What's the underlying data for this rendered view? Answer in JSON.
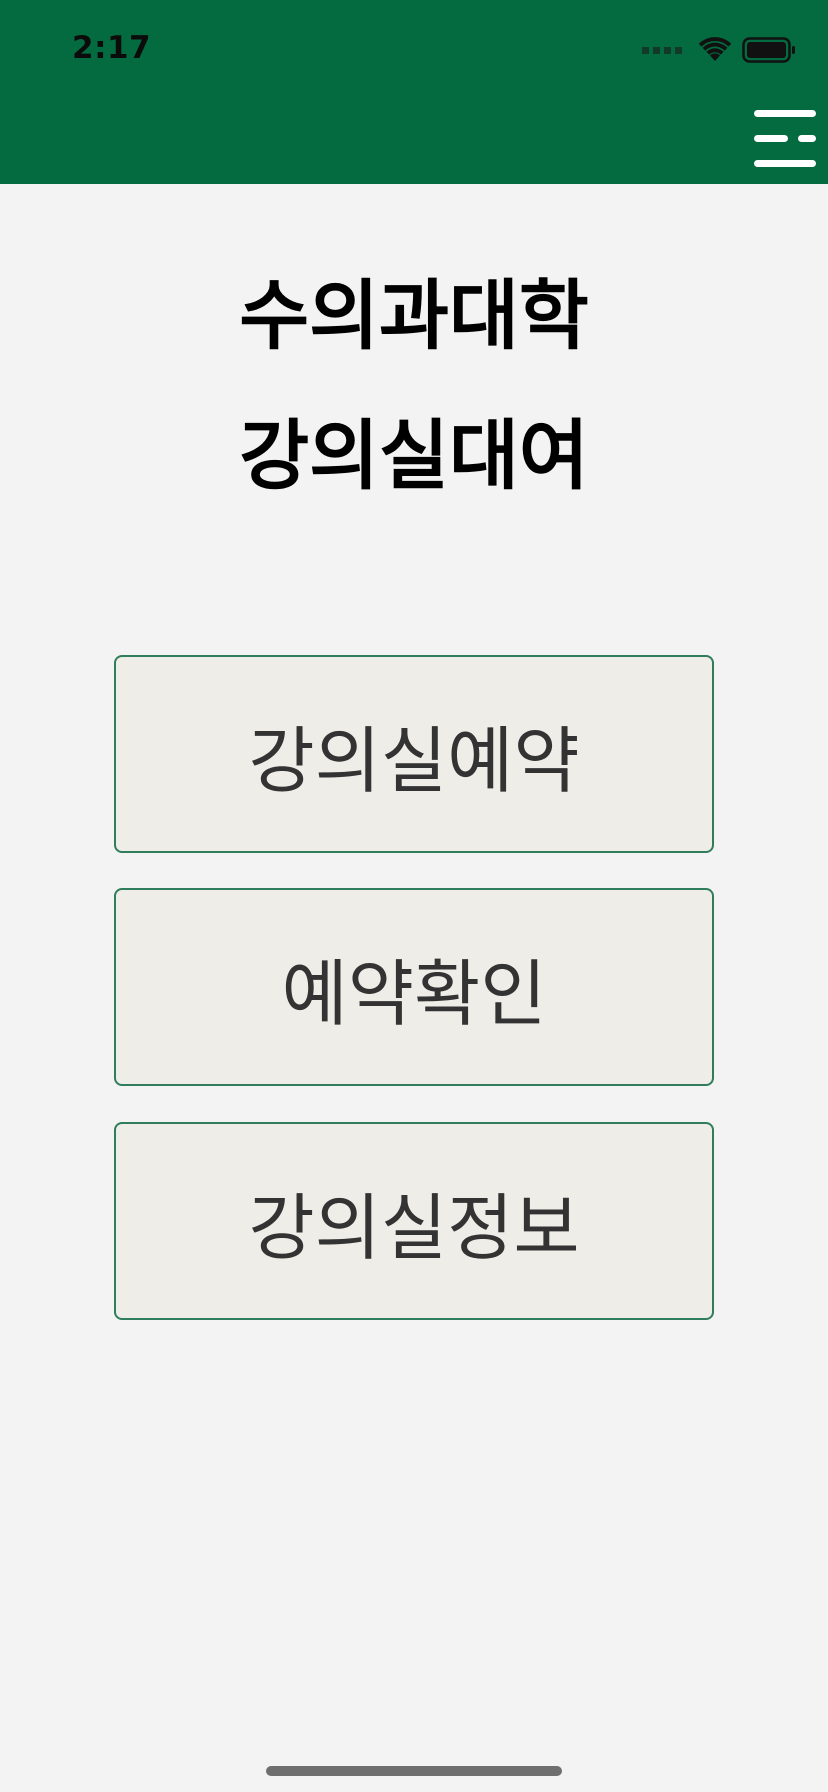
{
  "status_bar": {
    "time": "2:17",
    "icons": [
      "cellular-signal-icon",
      "wifi-icon",
      "battery-icon"
    ]
  },
  "header": {
    "menu_icon": "hamburger-menu-icon",
    "background_color": "#046a3f"
  },
  "title": {
    "line1": "수의과대학",
    "line2": "강의실대여"
  },
  "menu": {
    "items": [
      {
        "label": "강의실예약"
      },
      {
        "label": "예약확인"
      },
      {
        "label": "강의실정보"
      }
    ]
  },
  "colors": {
    "button_border": "#2f7d5b",
    "button_background": "#efede8",
    "page_background": "#f3f3f3"
  }
}
